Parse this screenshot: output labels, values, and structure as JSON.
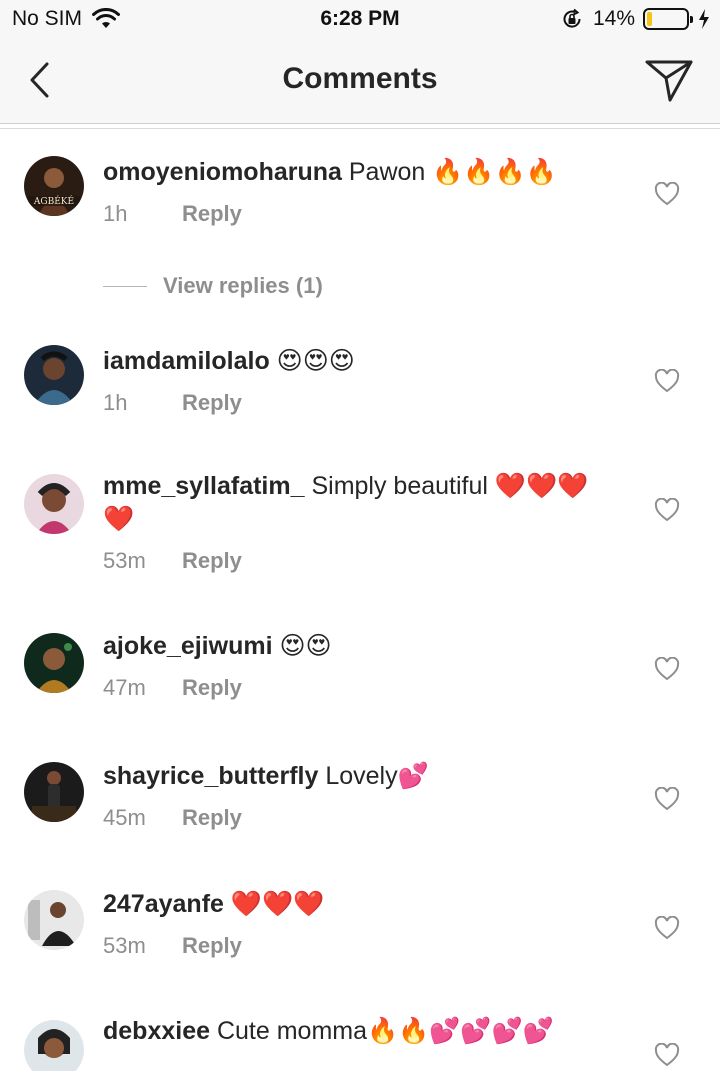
{
  "status_bar": {
    "carrier": "No SIM",
    "time": "6:28 PM",
    "battery": "14%",
    "battery_level": 0.14,
    "icons": [
      "wifi-icon",
      "rotation-lock-icon",
      "battery-icon",
      "charging-bolt-icon"
    ]
  },
  "nav": {
    "title": "Comments",
    "back_icon": "chevron-left-icon",
    "send_icon": "paper-plane-icon"
  },
  "comments": [
    {
      "user": "omoyeniomoharuna",
      "text": "Pawon 🔥🔥🔥🔥",
      "time": "1h",
      "reply": "Reply",
      "avatar_text": "AGBÉKÉ"
    },
    {
      "user": "iamdamilolalo",
      "text": "😍😍😍",
      "time": "1h",
      "reply": "Reply"
    },
    {
      "user": "mme_syllafatim_",
      "text": "Simply beautiful ❤️❤️❤️❤️",
      "time": "53m",
      "reply": "Reply"
    },
    {
      "user": "ajoke_ejiwumi",
      "text": "😍😍",
      "time": "47m",
      "reply": "Reply"
    },
    {
      "user": "shayrice_butterfly",
      "text": "Lovely💕",
      "time": "45m",
      "reply": "Reply"
    },
    {
      "user": "247ayanfe",
      "text": "❤️❤️❤️",
      "time": "53m",
      "reply": "Reply"
    },
    {
      "user": "debxxiee",
      "text": "Cute momma🔥🔥💕💕💕💕",
      "time": "",
      "reply": ""
    }
  ],
  "view_replies": "View replies (1)",
  "colors": {
    "text": "#262626",
    "meta": "#8e8e8e",
    "bar_bg": "#f7f7f7",
    "battery_fill": "#f5c518"
  }
}
